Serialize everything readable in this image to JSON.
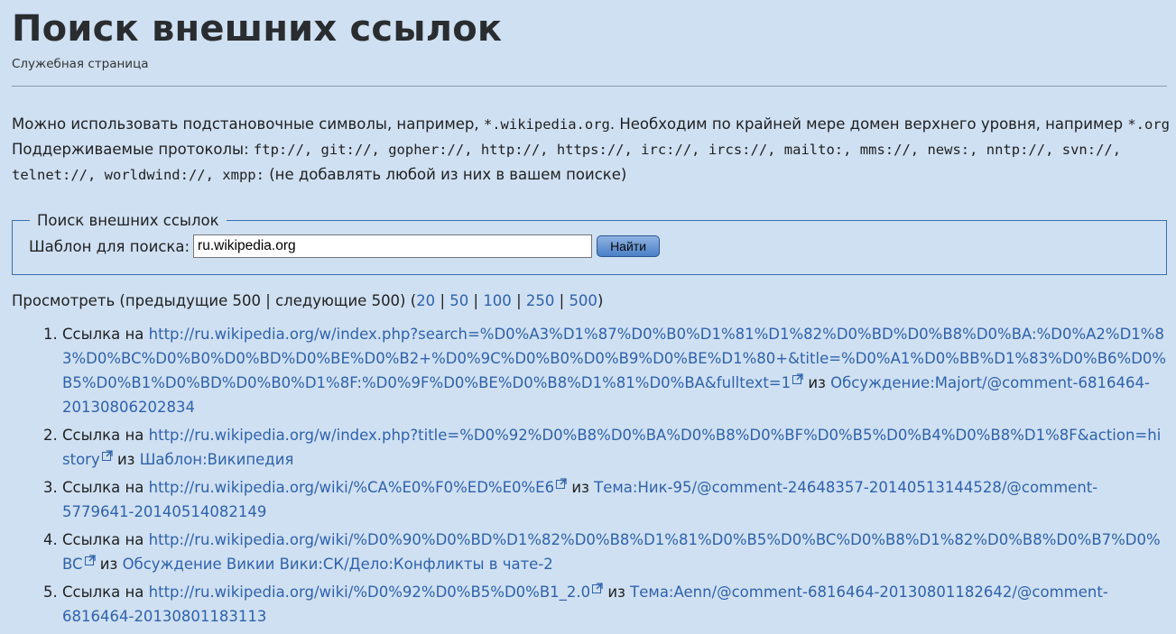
{
  "header": {
    "title": "Поиск внешних ссылок",
    "subtitle": "Служебная страница"
  },
  "intro": {
    "line1_prefix": "Можно использовать подстановочные символы, например, ",
    "line1_example": "*.wikipedia.org",
    "line1_middle": ". Необходим по крайней мере домен верхнего уровня, например ",
    "line1_example2": "*.org",
    "line2_prefix": "Поддерживаемые протоколы: ",
    "protocols_line2": "ftp://, git://, gopher://, http://, https://, irc://, ircs://, mailto:, mms://, news:, nntp://, svn://,",
    "protocols_line3": "telnet://, worldwind://, xmpp:",
    "line3_suffix": " (не добавлять любой из них в вашем поиске)"
  },
  "search_form": {
    "legend": "Поиск внешних ссылок",
    "label": "Шаблон для поиска:",
    "value": "ru.wikipedia.org",
    "button_label": "Найти"
  },
  "pagination": {
    "prefix": "Просмотреть (предыдущие 500 ",
    "sep": "|",
    "next": " следующие 500) (",
    "limits": [
      "20",
      "50",
      "100",
      "250",
      "500"
    ],
    "suffix": ")"
  },
  "results": [
    {
      "prefix": "Ссылка на ",
      "url": "http://ru.wikipedia.org/w/index.php?search=%D0%A3%D1%87%D0%B0%D1%81%D1%82%D0%BD%D0%B8%D0%BA:%D0%A2%D1%83%D0%BC%D0%B0%D0%BD%D0%BE%D0%B2+%D0%9C%D0%B0%D0%B9%D0%BE%D1%80+&title=%D0%A1%D0%BB%D1%83%D0%B6%D0%B5%D0%B1%D0%BD%D0%B0%D1%8F:%D0%9F%D0%BE%D0%B8%D1%81%D0%BA&fulltext=1",
      "from_word": " из ",
      "page": "Обсуждение:Majort/@comment-6816464-20130806202834"
    },
    {
      "prefix": "Ссылка на ",
      "url": "http://ru.wikipedia.org/w/index.php?title=%D0%92%D0%B8%D0%BA%D0%B8%D0%BF%D0%B5%D0%B4%D0%B8%D1%8F&action=history",
      "from_word": " из ",
      "page": "Шаблон:Википедия"
    },
    {
      "prefix": "Ссылка на ",
      "url": "http://ru.wikipedia.org/wiki/%CA%E0%F0%ED%E0%E6",
      "from_word": " из ",
      "page": "Тема:Ник-95/@comment-24648357-20140513144528/@comment-5779641-20140514082149"
    },
    {
      "prefix": "Ссылка на ",
      "url": "http://ru.wikipedia.org/wiki/%D0%90%D0%BD%D1%82%D0%B8%D1%81%D0%B5%D0%BC%D0%B8%D1%82%D0%B8%D0%B7%D0%BC",
      "from_word": " из ",
      "page": "Обсуждение Викии Вики:СК/Дело:Конфликты в чате-2"
    },
    {
      "prefix": "Ссылка на ",
      "url": "http://ru.wikipedia.org/wiki/%D0%92%D0%B5%D0%B1_2.0",
      "from_word": " из ",
      "page": "Тема:Aenn/@comment-6816464-20130801182642/@comment-6816464-20130801183113"
    }
  ],
  "icons": {
    "external_link": "external-link-icon"
  },
  "colors": {
    "background": "#cfe0f2",
    "link": "#2f62ac",
    "button": "#4a7fc6"
  }
}
